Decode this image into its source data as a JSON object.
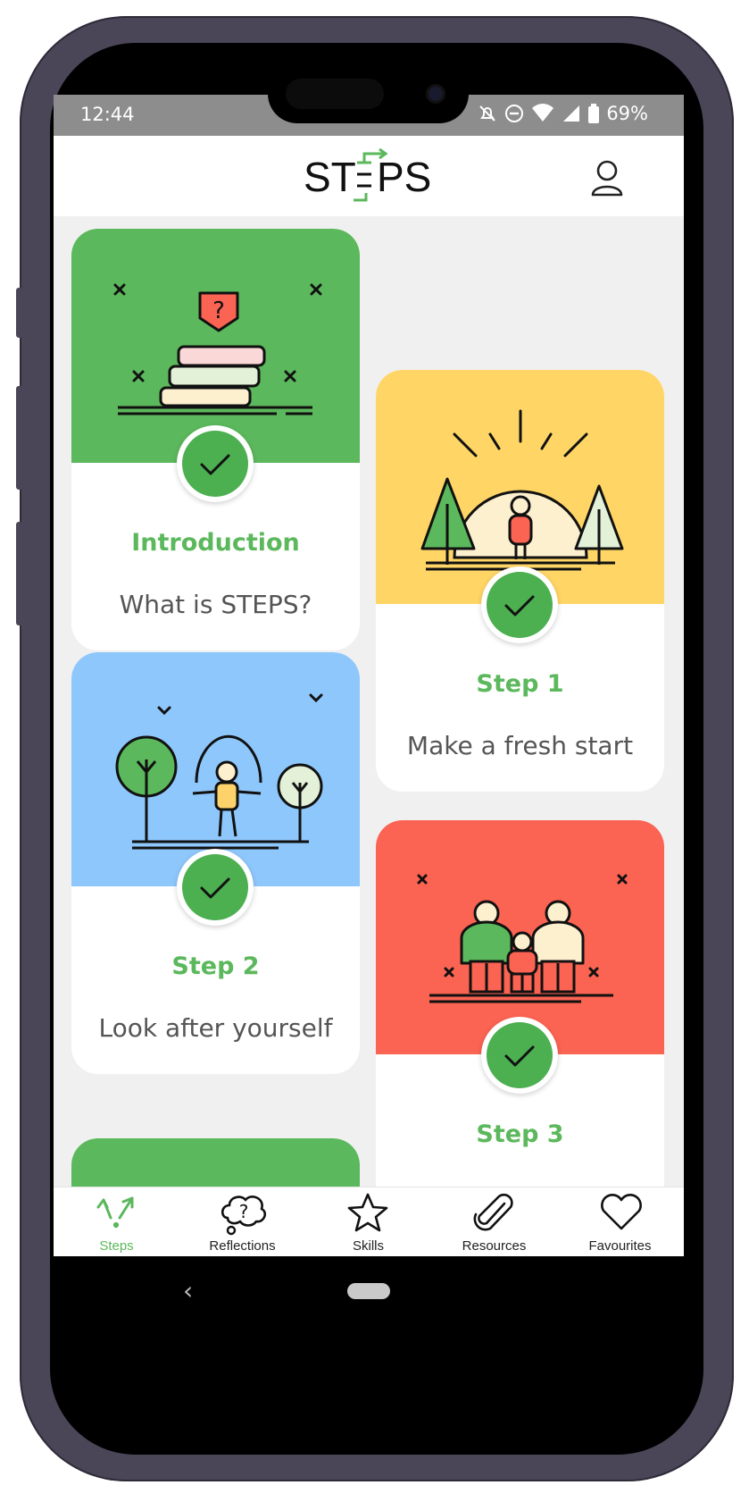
{
  "status": {
    "time": "12:44",
    "battery": "69%"
  },
  "header": {
    "logo": "ST=PS",
    "profile_icon": "user-icon"
  },
  "cards": [
    {
      "title": "Introduction",
      "subtitle": "What is STEPS?",
      "color": "#5cb85c",
      "completed": true
    },
    {
      "title": "Step 1",
      "subtitle": "Make a fresh start",
      "color": "#ffd566",
      "completed": true
    },
    {
      "title": "Step 2",
      "subtitle": "Look after yourself",
      "color": "#8ec7fb",
      "completed": true
    },
    {
      "title": "Step 3",
      "subtitle": "",
      "color": "#fb6352",
      "completed": true
    },
    {
      "title": "",
      "subtitle": "",
      "color": "#5cb85c",
      "completed": false
    }
  ],
  "nav": [
    {
      "label": "Steps",
      "icon": "steps-arrows-icon",
      "active": true
    },
    {
      "label": "Reflections",
      "icon": "thought-bubble-icon",
      "active": false
    },
    {
      "label": "Skills",
      "icon": "star-icon",
      "active": false
    },
    {
      "label": "Resources",
      "icon": "paperclip-icon",
      "active": false
    },
    {
      "label": "Favourites",
      "icon": "heart-icon",
      "active": false
    }
  ],
  "colors": {
    "accent": "#5cb85c",
    "check": "#4caf50"
  }
}
